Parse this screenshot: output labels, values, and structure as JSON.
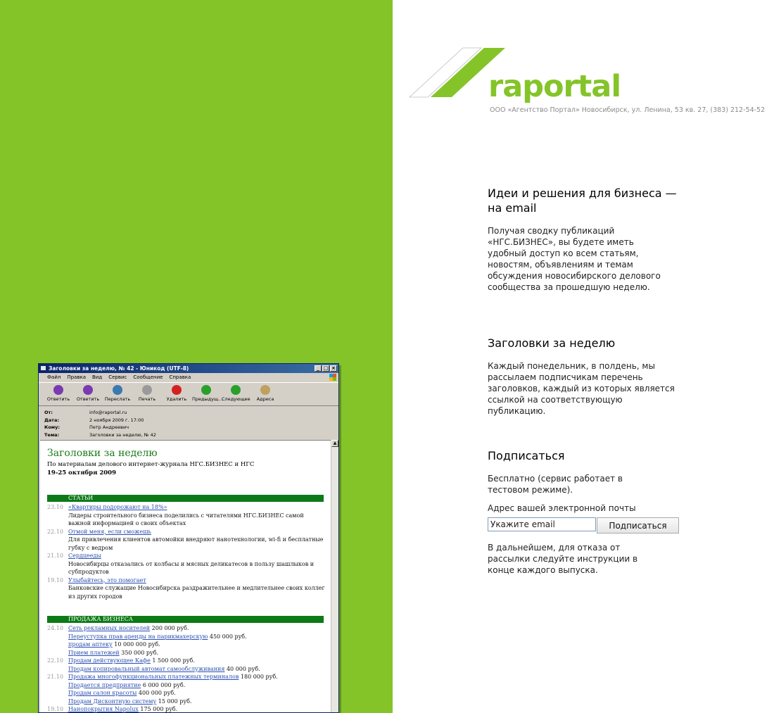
{
  "brand": {
    "name": "raportal",
    "company_line": "ООО «Агентство Портал» Новосибирск, ул. Ленина, 53 кв. 27, (383) 212-54-52",
    "accent": "#84c429"
  },
  "intro": {
    "title": "Идеи и решения для бизнеса — на email",
    "text": "Получая сводку публикаций «НГС.БИЗНЕС», вы будете иметь удобный доступ ко всем статьям, новостям, объявлениям и темам обсуждения новосибирского делового сообщества за прошедшую неделю."
  },
  "headlines": {
    "title": "Заголовки за неделю",
    "text": "Каждый понедельник, в полдень, мы рассылаем подписчикам перечень заголовков, каждый из которых является ссылкой на соответствующую публикацию."
  },
  "subscribe": {
    "title": "Подписаться",
    "free_note": "Бесплатно (сервис работает в тестовом режиме).",
    "email_label": "Адрес вашей электронной почты",
    "email_placeholder": "Укажите email",
    "button": "Подписаться",
    "unsubscribe_note": "В дальнейшем, для отказа от рассылки следуйте инструкции в конце каждого выпуска."
  },
  "mail_window": {
    "title": "Заголовки за неделю, № 42 - Юникод (UTF-8)",
    "menu": [
      "Файл",
      "Правка",
      "Вид",
      "Сервис",
      "Сообщение",
      "Справка"
    ],
    "toolbar": [
      {
        "label": "Ответить",
        "icon": "reply-icon",
        "color": "#7a3ab0"
      },
      {
        "label": "Ответить ...",
        "icon": "reply-all-icon",
        "color": "#7a3ab0"
      },
      {
        "label": "Переслать",
        "icon": "forward-icon",
        "color": "#3a7ab0"
      },
      {
        "label": "Печать",
        "icon": "print-icon",
        "color": "#9a9a9a"
      },
      {
        "label": "Удалить",
        "icon": "delete-icon",
        "color": "#d42020"
      },
      {
        "label": "Предыдущ...",
        "icon": "previous-icon",
        "color": "#2aa02a"
      },
      {
        "label": "Следующее",
        "icon": "next-icon",
        "color": "#2aa02a"
      },
      {
        "label": "Адреса",
        "icon": "address-book-icon",
        "color": "#c0a060"
      }
    ],
    "headers": {
      "from_label": "От:",
      "from": "info@raportal.ru",
      "date_label": "Дата:",
      "date": "2 ноября 2009 г. 17:00",
      "to_label": "Кому:",
      "to": "Петр Андреевич",
      "subject_label": "Тема:",
      "subject": "Заголовки за неделю, № 42"
    },
    "body": {
      "title": "Заголовки за неделю",
      "subtitle": "По материалам делового интернет-журнала НГС.БИЗНЕС и НГС",
      "dates": "19-25 октября 2009",
      "sections": [
        {
          "name": "СТАТЬИ",
          "items": [
            {
              "date": "23.10",
              "link": "«Квартиры подорожают на 18%»",
              "price": "",
              "desc": "Лидеры строительного бизнеса поделились с читателями НГС.БИЗНЕС самой важной информацией о своих объектах"
            },
            {
              "date": "22.10",
              "link": "Отмой меня, если сможешь",
              "price": "",
              "desc": "Для привлечения клиентов автомойки внедряют нанотехнологии, wi-fi и бесплатные губку с ведром"
            },
            {
              "date": "21.10",
              "link": "Сердцееды",
              "price": "",
              "desc": "Новосибирцы отказались от колбасы и мясных деликатесов в пользу шашлыков и субпродуктов"
            },
            {
              "date": "19.10",
              "link": "Улыбайтесь, это помогает",
              "price": "",
              "desc": "Банковские служащие Новосибирска раздражительнее и медлительнее своих коллег из других городов"
            }
          ]
        },
        {
          "name": "ПРОДАЖА БИЗНЕСА",
          "items": [
            {
              "date": "24.10",
              "link": "Сеть рекламных носителей",
              "price": "200 000 руб."
            },
            {
              "date": "",
              "link": "Переуступка прав аренды на парикмахерскую",
              "price": "450 000 руб."
            },
            {
              "date": "",
              "link": "продам аптеку",
              "price": "10 000 000 руб."
            },
            {
              "date": "",
              "link": "Прием платежей",
              "price": "350 000 руб."
            },
            {
              "date": "22.10",
              "link": "Продам действующее Кафе",
              "price": "1 500 000 руб."
            },
            {
              "date": "",
              "link": "Продам копировальный автомат самообслуживания",
              "price": "40 000 руб."
            },
            {
              "date": "21.10",
              "link": "Продажа многофункциональных платежных терминалов",
              "price": "180 000 руб."
            },
            {
              "date": "",
              "link": "Продается предприятие",
              "price": "6 000 000 руб."
            },
            {
              "date": "",
              "link": "Продам салон красоты",
              "price": "400 000 руб."
            },
            {
              "date": "",
              "link": "Продам Дисконтную систему",
              "price": "15 000 руб."
            },
            {
              "date": "19.10",
              "link": "Нанопокрытия Napolux",
              "price": "175 000 руб."
            }
          ]
        }
      ]
    }
  }
}
